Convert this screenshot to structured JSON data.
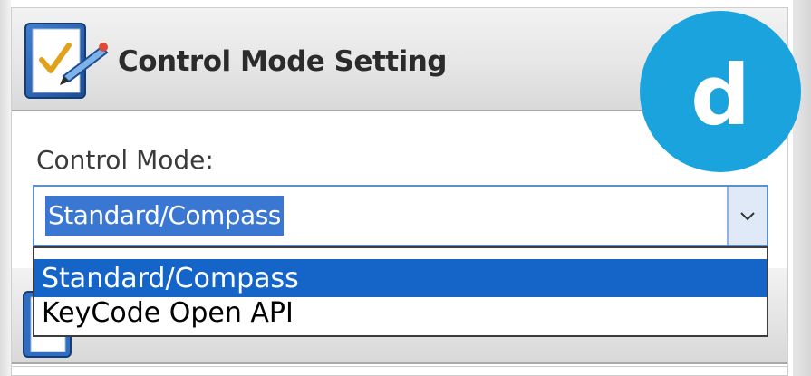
{
  "panel": {
    "header": {
      "title": "Control Mode Setting",
      "icon": "checklist-pen-icon"
    },
    "control_mode": {
      "label": "Control Mode:",
      "selected_value": "Standard/Compass",
      "options": [
        {
          "label": "Standard/Compass",
          "highlighted": true
        },
        {
          "label": "KeyCode Open API",
          "highlighted": false
        }
      ],
      "dropdown_icon": "chevron-down-icon"
    }
  },
  "badge": {
    "letter": "d",
    "color": "#1aa3dc"
  },
  "colors": {
    "selection": "#1565c8",
    "combo_border": "#5d90c9"
  }
}
